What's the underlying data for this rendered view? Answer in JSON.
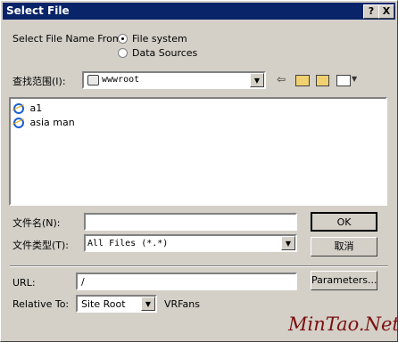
{
  "window": {
    "title": "Select File"
  },
  "title_buttons": {
    "help": "?",
    "close": "X"
  },
  "select_from": {
    "label": "Select File Name From:",
    "options": [
      "File system",
      "Data Sources"
    ],
    "selected": "File system"
  },
  "lookin": {
    "label": "查找范围(I):",
    "value": "wwwroot"
  },
  "files": [
    {
      "name": "a1"
    },
    {
      "name": "asia man"
    }
  ],
  "filename": {
    "label": "文件名(N):",
    "value": ""
  },
  "filetype": {
    "label": "文件类型(T):",
    "value": "All Files (*.*)"
  },
  "buttons": {
    "ok": "OK",
    "cancel": "取消",
    "parameters": "Parameters..."
  },
  "url": {
    "label": "URL:",
    "value": "/"
  },
  "relative": {
    "label": "Relative To:",
    "value": "Site Root",
    "site": "VRFans"
  },
  "watermark": "MinTao.Net",
  "icons": [
    "help-icon",
    "close-icon",
    "folder-icon",
    "back-arrow-icon",
    "up-folder-icon",
    "new-folder-icon",
    "view-menu-icon",
    "ie-document-icon"
  ],
  "colors": {
    "titlebar": "#0a246a",
    "face": "#d4d0c8",
    "watermark": "#7a1010"
  }
}
